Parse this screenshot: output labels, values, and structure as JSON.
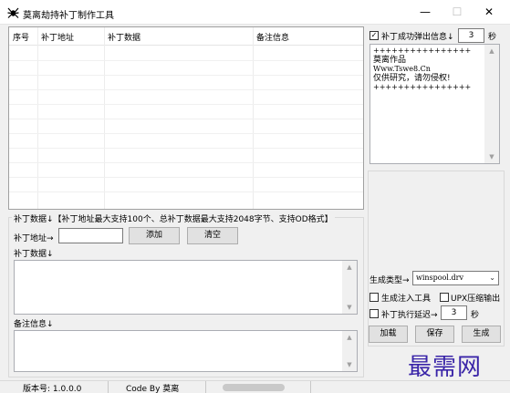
{
  "window": {
    "title": "莫离劫持补丁制作工具",
    "minimize_glyph": "—",
    "maximize_glyph": "☐",
    "close_glyph": "✕"
  },
  "table": {
    "columns": [
      "序号",
      "补丁地址",
      "补丁数据",
      "备注信息"
    ],
    "rows": []
  },
  "patch_section": {
    "header": "补丁数据↓【补丁地址最大支持100个、总补丁数据最大支持2048字节、支持OD格式】",
    "address_label": "补丁地址→",
    "address_value": "",
    "add_button": "添加",
    "clear_button": "清空",
    "data_label": "补丁数据↓",
    "data_value": "",
    "note_label": "备注信息↓",
    "note_value": ""
  },
  "popup": {
    "checkbox_label": "补丁成功弹出信息↓",
    "checked": true,
    "seconds_value": "3",
    "seconds_unit": "秒",
    "message_lines": [
      "++++++++++++++++",
      "莫离作品",
      "Www.Tswe8.Cn",
      "仅供研究，请勿侵权!",
      "++++++++++++++++"
    ]
  },
  "generate": {
    "type_label": "生成类型→",
    "type_value": "winspool.drv",
    "inject_label": "生成注入工具",
    "inject_checked": false,
    "upx_label": "UPX压缩输出",
    "upx_checked": false,
    "delay_label": "补丁执行延迟→",
    "delay_checked": false,
    "delay_value": "3",
    "delay_unit": "秒",
    "load_button": "加载",
    "save_button": "保存",
    "generate_button": "生成"
  },
  "statusbar": {
    "version": "版本号: 1.0.0.0",
    "author": "Code By 莫离"
  },
  "watermark": "最需网"
}
